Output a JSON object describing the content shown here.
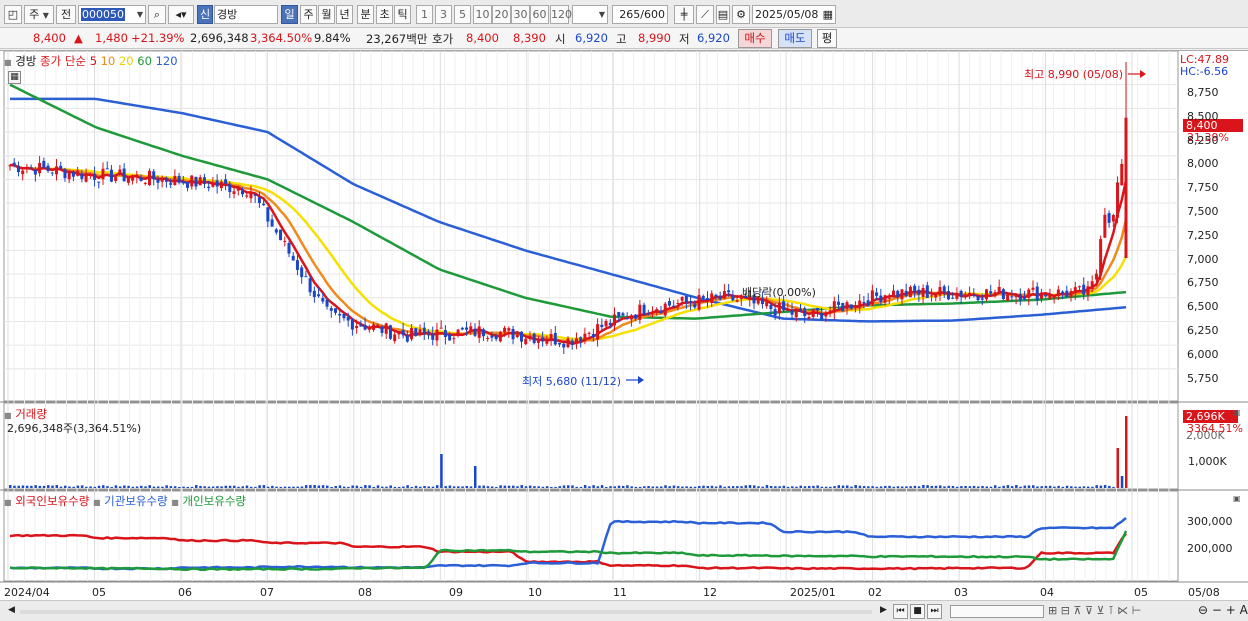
{
  "toolbar": {
    "type_select": "주",
    "prev_label": "전",
    "code": "000050",
    "market_badge": "신",
    "stock_name": "경방",
    "periods": [
      "일",
      "주",
      "월",
      "년",
      "분",
      "초",
      "틱"
    ],
    "active_period": "일",
    "counts": [
      "1",
      "3",
      "5",
      "10",
      "20",
      "30",
      "60",
      "120"
    ],
    "visible_count": "265",
    "total_count": "/600",
    "date": "2025/05/08"
  },
  "quote": {
    "price": "8,400",
    "up_arrow": "▲",
    "change": "1,480",
    "change_pct": "+21.39%",
    "volume": "2,696,348",
    "volume_ratio": "3,364.50%",
    "turnover": "9.84%",
    "amount": "23,267백만",
    "bid_ask_label": "호가",
    "ask": "8,400",
    "bid": "8,390",
    "open_label": "시",
    "open": "6,920",
    "high_label": "고",
    "high": "8,990",
    "low_label": "저",
    "low": "6,920",
    "buy_button": "매수",
    "sell_button": "매도",
    "eval_button": "평"
  },
  "price_panel": {
    "stock_label": "경방",
    "legend_title": "종가 단순",
    "ma_periods": [
      "5",
      "10",
      "20",
      "60",
      "120"
    ],
    "lc": "LC:47.89",
    "hc": "HC:-6.56",
    "high_annotation": "최고 8,990 (05/08)",
    "low_annotation": "최저 5,680 (11/12)",
    "dividend_annotation": "배당락(0.00%)",
    "last_price_tag": "8,400",
    "last_pct_tag": "21.39%",
    "y_ticks": [
      "8,750",
      "8,500",
      "8,250",
      "8,000",
      "7,750",
      "7,500",
      "7,250",
      "7,000",
      "6,750",
      "6,500",
      "6,250",
      "6,000",
      "5,750"
    ]
  },
  "volume_panel": {
    "title": "거래량",
    "value_line": "2,696,348주(3,364.51%)",
    "tag_value": "2,696K",
    "tag_pct": "3364.51%",
    "tag_cut": "2,000K",
    "y_ticks": [
      "1,000K"
    ]
  },
  "holding_panel": {
    "series_names": [
      "외국인보유수량",
      "기관보유수량",
      "개인보유수량"
    ],
    "y_ticks": [
      "300,000",
      "200,000"
    ]
  },
  "x_axis": [
    "2024/04",
    "05",
    "06",
    "07",
    "08",
    "09",
    "10",
    "11",
    "12",
    "2025/01",
    "02",
    "03",
    "04",
    "05",
    "05/08"
  ],
  "colors": {
    "up": "#d9141a",
    "down": "#1a46c8",
    "ma5": "#d9141a",
    "ma10": "#f08a1c",
    "ma20": "#f5e000",
    "ma60": "#1f9a3a",
    "ma120": "#2a5fd6",
    "foreign": "#d9141a",
    "institution": "#2a5fd6",
    "individual": "#1f9a3a"
  },
  "chart_data": {
    "type": "candlestick",
    "price_range": [
      5600,
      9000
    ],
    "x_labels": [
      "2024/04",
      "05",
      "06",
      "07",
      "08",
      "09",
      "10",
      "11",
      "12",
      "2025/01",
      "02",
      "03",
      "04",
      "05"
    ],
    "annotations": {
      "high": 8990,
      "high_date": "05/08",
      "low": 5680,
      "low_date": "11/12"
    },
    "monthly_close_approx": [
      {
        "month": "2024/04",
        "close": 7900
      },
      {
        "month": "2024/05",
        "close": 7800
      },
      {
        "month": "2024/06",
        "close": 7750
      },
      {
        "month": "2024/07",
        "close": 7650
      },
      {
        "month": "2024/08",
        "close": 6300
      },
      {
        "month": "2024/09",
        "close": 6100
      },
      {
        "month": "2024/10",
        "close": 6150
      },
      {
        "month": "2024/11",
        "close": 6050
      },
      {
        "month": "2024/12",
        "close": 6400
      },
      {
        "month": "2025/01",
        "close": 6500
      },
      {
        "month": "2025/02",
        "close": 6300
      },
      {
        "month": "2025/03",
        "close": 6550
      },
      {
        "month": "2025/04",
        "close": 6550
      },
      {
        "month": "2025/05",
        "close": 8400
      }
    ],
    "ma120_path": [
      8600,
      8600,
      8450,
      8250,
      7700,
      7300,
      7000,
      6750,
      6500,
      6280,
      6250,
      6260,
      6320,
      6400
    ],
    "ma60_path": [
      8750,
      8300,
      8000,
      7750,
      7300,
      6800,
      6500,
      6300,
      6280,
      6350,
      6420,
      6440,
      6480,
      6560
    ],
    "holding_series": [
      {
        "name": "외국인보유수량",
        "path": [
          280000,
          270000,
          260000,
          250000,
          235000,
          215000,
          175000,
          160000,
          150000,
          148000,
          148000,
          150000,
          210000,
          290000
        ]
      },
      {
        "name": "기관보유수량",
        "path": [
          150000,
          148000,
          152000,
          155000,
          152000,
          160000,
          170000,
          335000,
          330000,
          295000,
          275000,
          275000,
          310000,
          350000
        ]
      },
      {
        "name": "개인보유수량",
        "path": [
          150000,
          148000,
          145000,
          146000,
          150000,
          220000,
          215000,
          210000,
          200000,
          198000,
          196000,
          195000,
          185000,
          300000
        ]
      }
    ]
  }
}
